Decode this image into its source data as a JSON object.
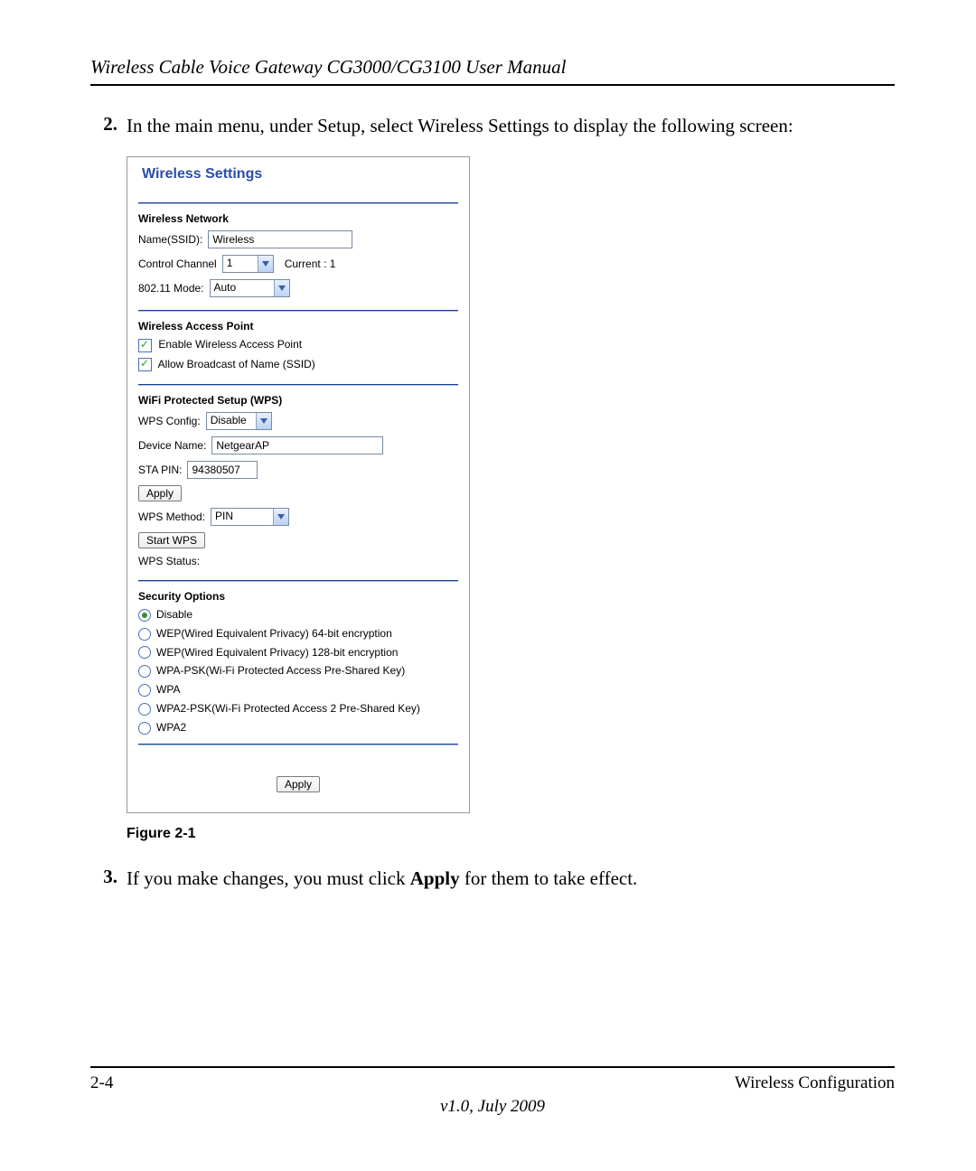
{
  "header": {
    "title": "Wireless Cable Voice Gateway CG3000/CG3100 User Manual"
  },
  "steps": {
    "s2": {
      "num": "2.",
      "text": "In the main menu, under Setup, select Wireless Settings to display the following screen:"
    },
    "s3": {
      "num": "3.",
      "pre": "If you make changes, you must click ",
      "bold": "Apply",
      "post": " for them to take effect."
    }
  },
  "figure": {
    "title": "Wireless Settings",
    "network": {
      "hdr": "Wireless Network",
      "ssid_label": "Name(SSID):",
      "ssid_value": "Wireless",
      "cc_label": "Control Channel",
      "cc_value": "1",
      "cc_current": "Current : 1",
      "mode_label": "802.11 Mode:",
      "mode_value": "Auto"
    },
    "ap": {
      "hdr": "Wireless Access Point",
      "c1": "Enable Wireless Access Point",
      "c2": "Allow Broadcast of Name (SSID)"
    },
    "wps": {
      "hdr": "WiFi Protected Setup (WPS)",
      "cfg_label": "WPS Config:",
      "cfg_value": "Disable",
      "dev_label": "Device Name:",
      "dev_value": "NetgearAP",
      "sta_label": "STA PIN:",
      "sta_value": "94380507",
      "apply": "Apply",
      "method_label": "WPS Method:",
      "method_value": "PIN",
      "start": "Start WPS",
      "status": "WPS Status:"
    },
    "sec": {
      "hdr": "Security Options",
      "o1": "Disable",
      "o2": "WEP(Wired Equivalent Privacy) 64-bit encryption",
      "o3": "WEP(Wired Equivalent Privacy) 128-bit encryption",
      "o4": "WPA-PSK(Wi-Fi Protected Access Pre-Shared Key)",
      "o5": "WPA",
      "o6": "WPA2-PSK(Wi-Fi Protected Access 2 Pre-Shared Key)",
      "o7": "WPA2"
    },
    "apply_btn": "Apply",
    "caption": "Figure 2-1"
  },
  "footer": {
    "page": "2-4",
    "section": "Wireless Configuration",
    "version": "v1.0, July 2009"
  }
}
